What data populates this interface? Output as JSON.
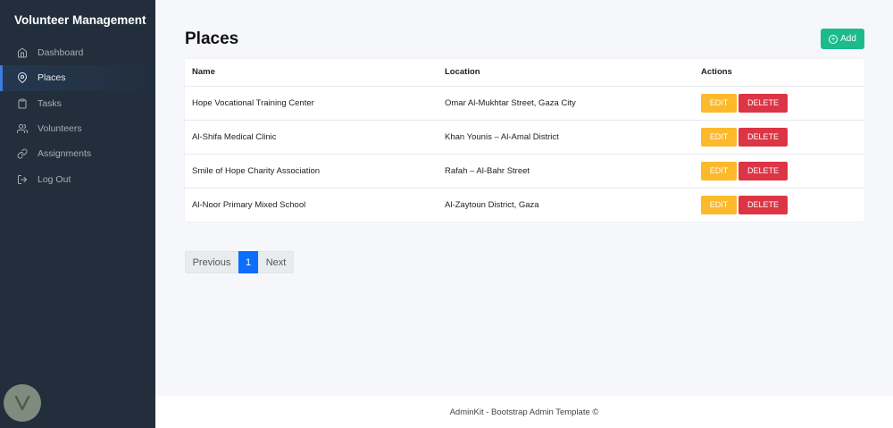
{
  "app": {
    "title": "Volunteer Management"
  },
  "sidebar": {
    "items": [
      {
        "label": "Dashboard",
        "icon": "home-icon"
      },
      {
        "label": "Places",
        "icon": "map-pin-icon",
        "active": true
      },
      {
        "label": "Tasks",
        "icon": "clipboard-icon"
      },
      {
        "label": "Volunteers",
        "icon": "users-icon"
      },
      {
        "label": "Assignments",
        "icon": "link-icon"
      },
      {
        "label": "Log Out",
        "icon": "log-out-icon"
      }
    ]
  },
  "page": {
    "title": "Places",
    "add_label": "Add"
  },
  "table": {
    "headers": [
      "Name",
      "Location",
      "Actions"
    ],
    "rows": [
      {
        "name": "Hope Vocational Training Center",
        "location": "Omar Al-Mukhtar Street, Gaza City"
      },
      {
        "name": "Al-Shifa Medical Clinic",
        "location": "Khan Younis – Al-Amal District"
      },
      {
        "name": "Smile of Hope Charity Association",
        "location": "Rafah – Al-Bahr Street"
      },
      {
        "name": "Al-Noor Primary Mixed School",
        "location": "Al-Zaytoun District, Gaza"
      }
    ],
    "edit_label": "EDIT",
    "delete_label": "DELETE"
  },
  "pagination": {
    "previous": "Previous",
    "current": "1",
    "next": "Next"
  },
  "footer": {
    "text": "AdminKit - Bootstrap Admin Template ©"
  },
  "colors": {
    "sidebar_bg": "#222e3c",
    "accent": "#3b7ddd",
    "add_button": "#1cbb8c",
    "edit_button": "#fcb92c",
    "delete_button": "#dc3545",
    "page_active": "#0d6efd"
  }
}
